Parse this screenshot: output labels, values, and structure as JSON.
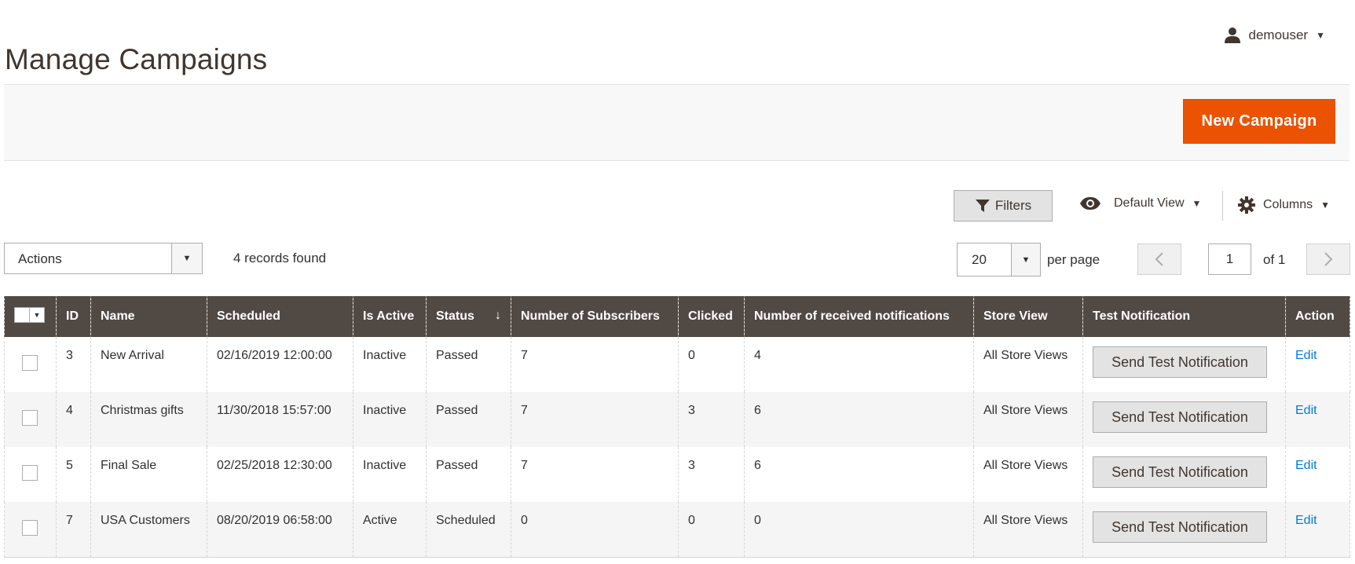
{
  "header": {
    "title": "Manage Campaigns",
    "username": "demouser"
  },
  "action_bar": {
    "new_button_label": "New Campaign"
  },
  "toolbar": {
    "filters_label": "Filters",
    "view_label": "Default View",
    "columns_label": "Columns",
    "actions_label": "Actions",
    "records_found": "4 records found",
    "per_page_value": "20",
    "per_page_label": "per page",
    "current_page": "1",
    "page_of": "of 1"
  },
  "grid": {
    "columns": [
      "ID",
      "Name",
      "Scheduled",
      "Is Active",
      "Status",
      "Number of Subscribers",
      "Clicked",
      "Number of received notifications",
      "Store View",
      "Test Notification",
      "Action"
    ],
    "sort_arrow": "↓",
    "rows": [
      {
        "id": "3",
        "name": "New Arrival",
        "scheduled": "02/16/2019 12:00:00",
        "active": "Inactive",
        "status": "Passed",
        "subscribers": "7",
        "clicked": "0",
        "received": "4",
        "store": "All Store Views",
        "test": "Send Test Notification",
        "action": "Edit"
      },
      {
        "id": "4",
        "name": "Christmas gifts",
        "scheduled": "11/30/2018 15:57:00",
        "active": "Inactive",
        "status": "Passed",
        "subscribers": "7",
        "clicked": "3",
        "received": "6",
        "store": "All Store Views",
        "test": "Send Test Notification",
        "action": "Edit"
      },
      {
        "id": "5",
        "name": "Final Sale",
        "scheduled": "02/25/2018 12:30:00",
        "active": "Inactive",
        "status": "Passed",
        "subscribers": "7",
        "clicked": "3",
        "received": "6",
        "store": "All Store Views",
        "test": "Send Test Notification",
        "action": "Edit"
      },
      {
        "id": "7",
        "name": "USA Customers",
        "scheduled": "08/20/2019 06:58:00",
        "active": "Active",
        "status": "Scheduled",
        "subscribers": "0",
        "clicked": "0",
        "received": "0",
        "store": "All Store Views",
        "test": "Send Test Notification",
        "action": "Edit"
      }
    ]
  },
  "colors": {
    "accent": "#eb5202",
    "header_bg": "#514943",
    "link": "#007bdb"
  },
  "icons": {
    "user": "user-icon",
    "filter": "funnel-icon",
    "view": "eye-icon",
    "columns": "gear-icon"
  }
}
